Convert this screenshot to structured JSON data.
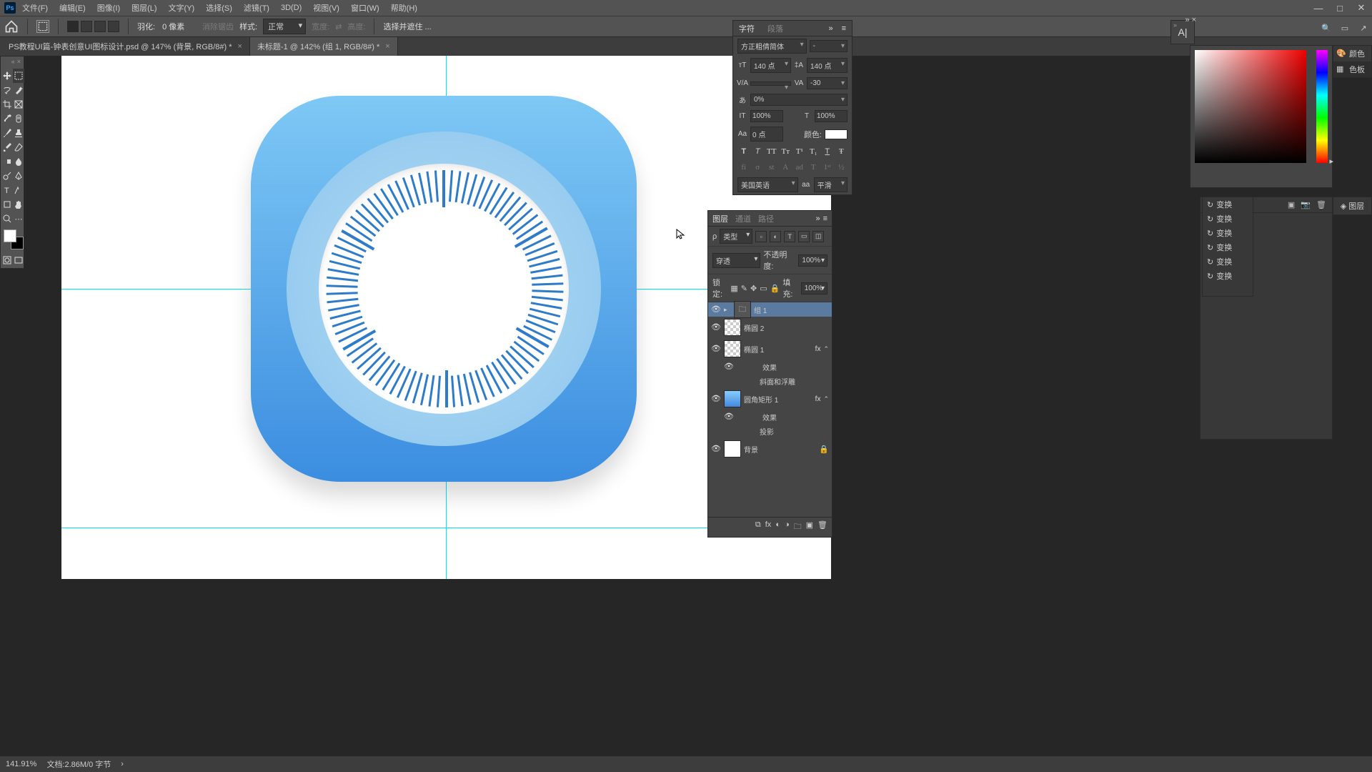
{
  "menu": {
    "file": "文件(F)",
    "edit": "编辑(E)",
    "image": "图像(I)",
    "layer": "图层(L)",
    "type": "文字(Y)",
    "select": "选择(S)",
    "filter": "滤镜(T)",
    "threed": "3D(D)",
    "view": "视图(V)",
    "window": "窗口(W)",
    "help": "帮助(H)"
  },
  "options": {
    "feather_lbl": "羽化:",
    "feather_val": "0 像素",
    "antialias": "消除锯齿",
    "style_lbl": "样式:",
    "style_val": "正常",
    "width_lbl": "宽度:",
    "height_lbl": "高度:",
    "selectmask": "选择并遮住 ..."
  },
  "tabs": {
    "t1": "PS教程UI篇-钟表创意UI图标设计.psd @ 147% (背景, RGB/8#) *",
    "t2": "未标题-1 @ 142% (组 1, RGB/8#) *"
  },
  "char": {
    "tab1": "字符",
    "tab2": "段落",
    "font": "方正粗倩简体",
    "style": "-",
    "size": "140 点",
    "leading": "140 点",
    "va": "V/A",
    "tracking": "-30",
    "scale": "0%",
    "vscale": "100%",
    "hscale": "100%",
    "baseline_lbl": "Aa",
    "baseline": "0 点",
    "color_lbl": "颜色:",
    "lang": "美国英语",
    "aa_lbl": "aa",
    "aa": "平滑",
    "pct": "%"
  },
  "color": {
    "tab1": "颜色",
    "tab2": "色板"
  },
  "layers": {
    "tab1": "图层",
    "tab2": "通道",
    "tab3": "路径",
    "kind": "类型",
    "blend": "穿透",
    "opacity_lbl": "不透明度:",
    "opacity": "100%",
    "lock_lbl": "锁定:",
    "fill_lbl": "填充:",
    "fill": "100%",
    "l1": "组 1",
    "l2": "椭圆 2",
    "l3": "椭圆 1",
    "l3a": "效果",
    "l3b": "斜面和浮雕",
    "l4": "圆角矩形 1",
    "l4a": "效果",
    "l4b": "投影",
    "l5": "背景",
    "fx": "fx",
    "search": "ρ"
  },
  "side": {
    "tab": "图层",
    "h1": "变换",
    "h2": "变换",
    "h3": "变换",
    "h4": "变换",
    "h5": "变换",
    "h6": "变换"
  },
  "status": {
    "zoom": "141.91%",
    "doc": "文档:2.86M/0 字节"
  },
  "abar": "A|"
}
